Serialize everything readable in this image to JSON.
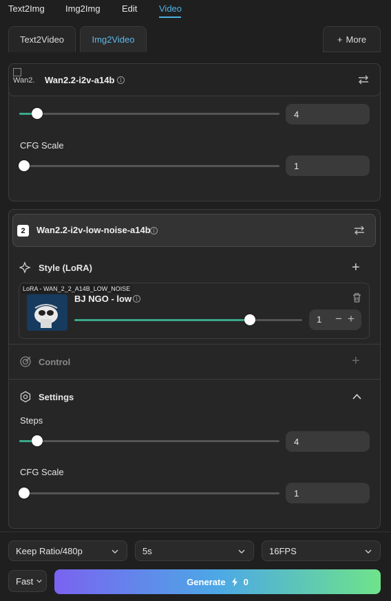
{
  "nav": {
    "tabs": [
      "Text2Img",
      "Img2Img",
      "Edit",
      "Video"
    ],
    "active": "Video"
  },
  "mode_tabs": {
    "items": [
      "Text2Video",
      "Img2Video"
    ],
    "active": "Img2Video",
    "more_label": "More"
  },
  "model1": {
    "thumb_alt": "Wan2.",
    "name": "Wan2.2-i2v-a14b",
    "steps_value": "4",
    "cfg_label": "CFG Scale",
    "cfg_value": "1"
  },
  "model2": {
    "index": "2",
    "name": "Wan2.2-i2v-low-noise-a14b",
    "style_label": "Style (LoRA)",
    "lora": {
      "tag": "LoRA - WAN_2_2_A14B_LOW_NOISE",
      "name": "BJ NGO - low",
      "value": "1",
      "strength": 0.77
    },
    "control_label": "Control",
    "settings_label": "Settings",
    "steps_label": "Steps",
    "steps_value": "4",
    "cfg_label": "CFG Scale",
    "cfg_value": "1"
  },
  "bottom": {
    "ratio": "Keep Ratio/480p",
    "duration": "5s",
    "fps": "16FPS",
    "speed": "Fast",
    "generate_label": "Generate",
    "cost": "0"
  },
  "colors": {
    "accent": "#4fb3e6",
    "slider_fill": "#3aa98a"
  }
}
